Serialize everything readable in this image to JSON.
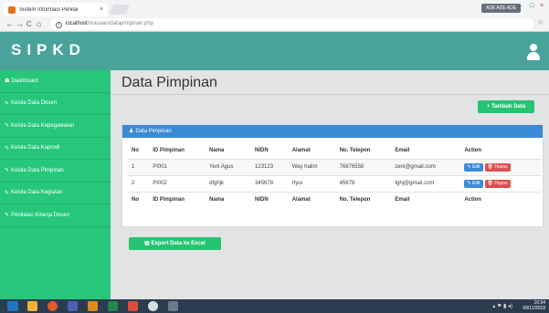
{
  "browser": {
    "tab_title": "Sistem Informasi Penilai",
    "tab_close": "×",
    "user_chip": "ADE ADE ADE",
    "back": "←",
    "forward": "→",
    "reload": "C",
    "home": "⌂",
    "url_host": "localhost",
    "url_path": "/masaan/datapimpinan.php",
    "star": "☆"
  },
  "header": {
    "brand": "SIPKD"
  },
  "sidebar": {
    "items": [
      {
        "icon": "☗",
        "label": "Dashboard"
      },
      {
        "icon": "✎",
        "label": "Kelola Data Dosen"
      },
      {
        "icon": "✎",
        "label": "Kelola Data Kepegawaian"
      },
      {
        "icon": "✎",
        "label": "Kelola Data Kaprodi"
      },
      {
        "icon": "✎",
        "label": "Kelola Data Pimpinan"
      },
      {
        "icon": "✎",
        "label": "Kelola Data Kegiatan"
      },
      {
        "icon": "✎",
        "label": "Penilaian Kinerja Dosen"
      }
    ]
  },
  "main": {
    "title": "Data Pimpinan",
    "add_button": "+ Tambah Data",
    "panel_title": "Data Pimpinan",
    "export_button": "Export Data ke Excel"
  },
  "table": {
    "columns": [
      "No",
      "ID Pimpinan",
      "Nama",
      "NIDN",
      "Alamat",
      "No. Telepon",
      "Email",
      "Action"
    ],
    "rows": [
      {
        "no": "1",
        "id": "PI001",
        "nama": "Yeni Agus",
        "nidn": "123123",
        "alamat": "Way halim",
        "telepon": "76876558",
        "email": "zeni@gmail.com"
      },
      {
        "no": "2",
        "id": "PI002",
        "nama": "dfghjk",
        "nidn": "345678",
        "alamat": "rtyui",
        "telepon": "45678",
        "email": "fghj@gmail.com"
      }
    ],
    "edit_label": "Edit",
    "delete_label": "Hapus"
  },
  "taskbar": {
    "time": "10:34",
    "date": "09/11/2018"
  },
  "colors": {
    "header_teal": "#4aa39b",
    "sidebar_green": "#26c77b",
    "button_green": "#25c471",
    "panel_blue": "#3b8ad6",
    "danger_red": "#e14d4d"
  }
}
